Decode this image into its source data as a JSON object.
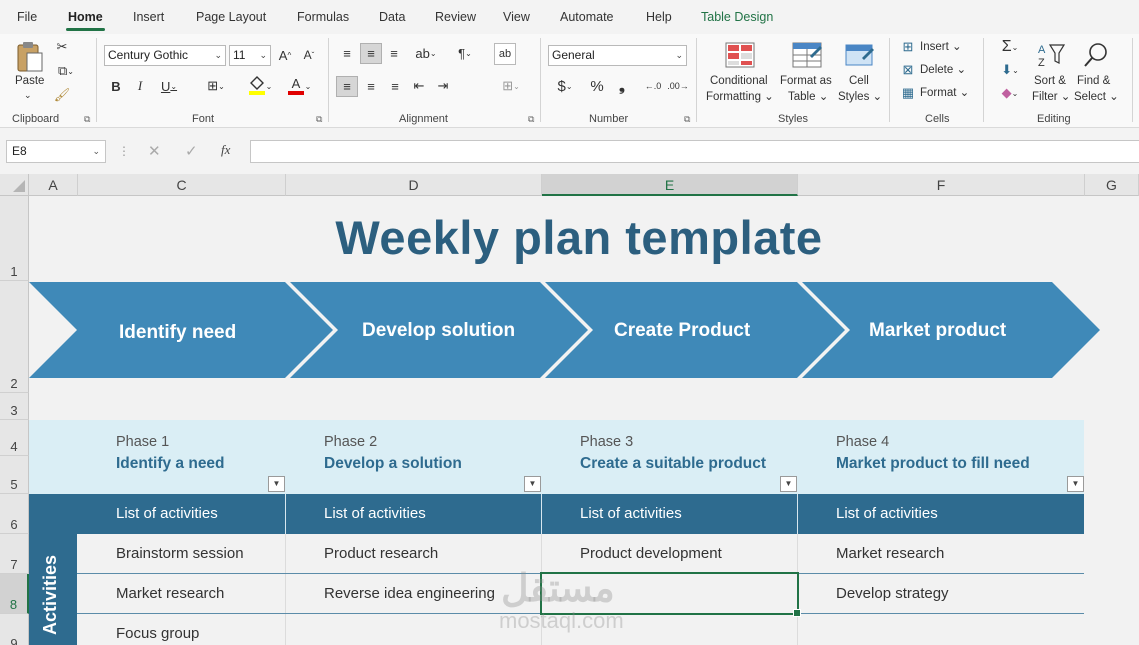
{
  "menu": {
    "tabs": [
      "File",
      "Home",
      "Insert",
      "Page Layout",
      "Formulas",
      "Data",
      "Review",
      "View",
      "Automate",
      "Help",
      "Table Design"
    ]
  },
  "ribbon": {
    "clipboard": {
      "paste": "Paste",
      "label": "Clipboard"
    },
    "font": {
      "family": "Century Gothic",
      "size": "11",
      "label": "Font",
      "fill_color": "#ffff00",
      "font_color": "#e00000"
    },
    "alignment": {
      "label": "Alignment"
    },
    "number": {
      "format": "General",
      "label": "Number"
    },
    "styles": {
      "conditional_line1": "Conditional",
      "conditional_line2": "Formatting",
      "format_table_line1": "Format as",
      "format_table_line2": "Table",
      "cell_styles_line1": "Cell",
      "cell_styles_line2": "Styles",
      "label": "Styles"
    },
    "cells": {
      "insert": "Insert",
      "delete": "Delete",
      "format": "Format",
      "label": "Cells"
    },
    "editing": {
      "sort_line1": "Sort &",
      "sort_line2": "Filter",
      "find_line1": "Find &",
      "find_line2": "Select",
      "label": "Editing"
    }
  },
  "formula_bar": {
    "name_box": "E8",
    "formula": "",
    "fx": "fx"
  },
  "grid": {
    "columns": [
      "A",
      "C",
      "D",
      "E",
      "F",
      "G"
    ],
    "selected_column": "E",
    "rows": [
      "1",
      "2",
      "3",
      "4",
      "5",
      "6",
      "7",
      "8",
      "9"
    ],
    "selected_row": "8"
  },
  "sheet": {
    "title": "Weekly plan template",
    "steps": [
      "Identify need",
      "Develop solution",
      "Create Product",
      "Market product"
    ],
    "phases": [
      {
        "num": "Phase 1",
        "title": "Identify a need"
      },
      {
        "num": "Phase 2",
        "title": "Develop a solution"
      },
      {
        "num": "Phase 3",
        "title": "Create a suitable product"
      },
      {
        "num": "Phase 4",
        "title": "Market product to fill need"
      }
    ],
    "list_header": "List of activities",
    "sidebar_label": "Activities",
    "activities": {
      "row7": [
        "Brainstorm session",
        "Product research",
        "Product development",
        "Market research"
      ],
      "row8": [
        "Market research",
        "Reverse idea engineering",
        "",
        "Develop strategy"
      ],
      "row9": [
        "Focus group",
        "",
        "",
        ""
      ]
    },
    "colors": {
      "dark_blue": "#2e6b8f",
      "arrow_blue": "#3a8bb8",
      "light_blue": "#daeef5",
      "title": "#2c5f7f"
    }
  },
  "watermark": {
    "arabic": "مستقل",
    "latin": "mostaql.com"
  }
}
